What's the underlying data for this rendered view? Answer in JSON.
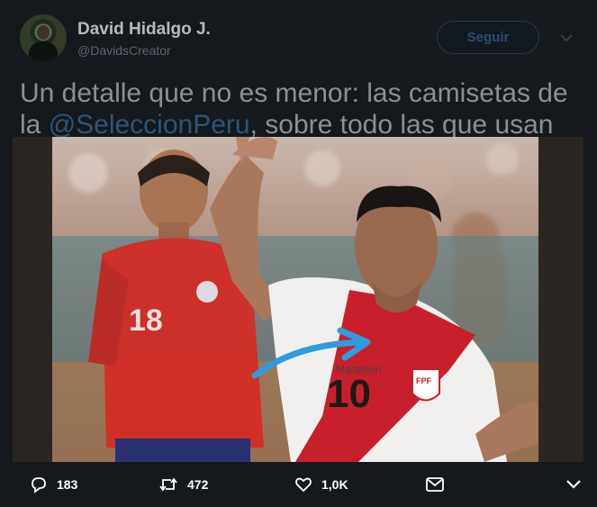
{
  "tweet": {
    "author_name": "David Hidalgo J.",
    "author_handle": "@DavidsCreator",
    "follow_label": "Seguir",
    "text_line1": "Un detalle que no es menor: las camisetas de",
    "text_prefix": "la ",
    "mention": "@SeleccionPeru",
    "text_suffix": ", sobre todo las que usan"
  },
  "media": {
    "left_jersey_number": "18",
    "center_jersey_number": "10",
    "brand_text": "Marathon",
    "crest_letters": "FPF",
    "colors": {
      "peru_red": "#c8202a",
      "chile_red": "#d52a22",
      "arrow_blue": "#2f9be0",
      "jersey_white": "#f1f0ee"
    }
  },
  "actions": {
    "reply_count": "183",
    "retweet_count": "472",
    "like_count": "1,0K",
    "icons": [
      "reply-icon",
      "retweet-icon",
      "like-icon",
      "message-icon",
      "chevron-down-icon"
    ]
  }
}
